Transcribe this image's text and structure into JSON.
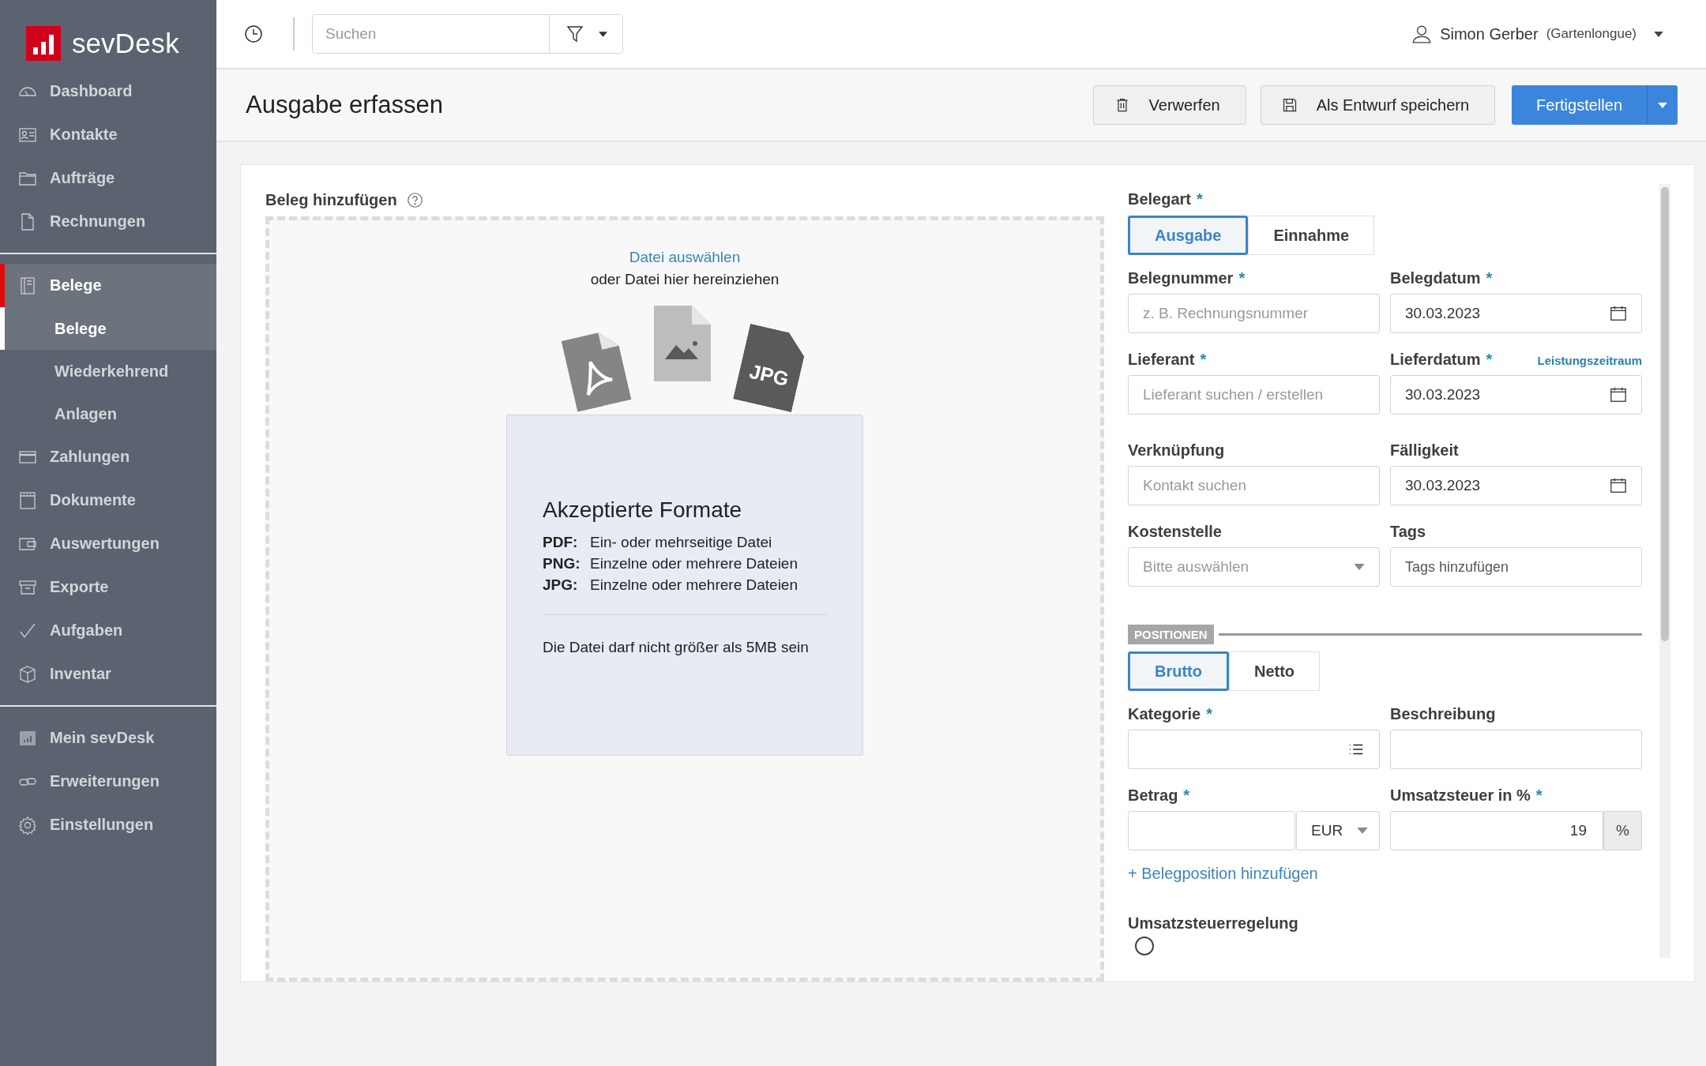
{
  "logo": {
    "text": "sev**Desk**"
  },
  "sidebar": {
    "groups": [
      {
        "items": [
          {
            "label": "Dashboard",
            "selected": false
          },
          {
            "label": "Kontakte",
            "selected": false
          },
          {
            "label": "Aufträge",
            "selected": false
          },
          {
            "label": "Rechnungen",
            "selected": false
          }
        ]
      },
      {
        "items": [
          {
            "label": "Belege",
            "selected": true,
            "children": [
              {
                "label": "Belege",
                "selected": true
              },
              {
                "label": "Wiederkehrend",
                "selected": false
              },
              {
                "label": "Anlagen",
                "selected": false
              }
            ]
          },
          {
            "label": "Zahlungen",
            "selected": false
          },
          {
            "label": "Dokumente",
            "selected": false
          },
          {
            "label": "Auswertungen",
            "selected": false
          },
          {
            "label": "Exporte",
            "selected": false
          },
          {
            "label": "Aufgaben",
            "selected": false
          },
          {
            "label": "Inventar",
            "selected": false
          }
        ]
      },
      {
        "items": [
          {
            "label": "Mein sevDesk",
            "selected": false
          },
          {
            "label": "Erweiterungen",
            "selected": false
          },
          {
            "label": "Einstellungen",
            "selected": false
          }
        ]
      }
    ]
  },
  "topbar": {
    "search_placeholder": "Suchen",
    "user_name": "Simon Gerber",
    "user_org": "(Gartenlongue)"
  },
  "header": {
    "title": "Ausgabe erfassen",
    "buttons": [
      {
        "label": "Verwerfen",
        "kind": "secondary"
      },
      {
        "label": "Als Entwurf speichern",
        "kind": "secondary"
      },
      {
        "label": "Fertigstellen",
        "kind": "primary"
      }
    ]
  },
  "upload": {
    "title": "Beleg hinzufügen",
    "link": "Datei auswählen",
    "hint": "oder Datei hier hereinziehen",
    "files": [
      {
        "kind": "pdf"
      },
      {
        "kind": "image"
      },
      {
        "kind": "jpg",
        "label": "JPG"
      }
    ],
    "formats": {
      "title": "Akzeptierte Formate",
      "rows": [
        {
          "format": "PDF:",
          "description": "Ein- oder mehrseitige Datei"
        },
        {
          "format": "PNG:",
          "description": "Einzelne oder mehrere Dateien"
        },
        {
          "format": "JPG:",
          "description": "Einzelne oder mehrere Dateien"
        }
      ],
      "note": "Die Datei darf nicht größer als 5MB sein"
    }
  },
  "form": {
    "required_mark": "*",
    "type": {
      "label": "Belegart",
      "required": true,
      "options": [
        {
          "label": "Ausgabe",
          "selected": true
        },
        {
          "label": "Einnahme",
          "selected": false
        }
      ]
    },
    "fields": [
      {
        "label": "Belegnummer",
        "required": true,
        "kind": "text",
        "placeholder": "z. B. Rechnungsnummer"
      },
      {
        "label": "Belegdatum",
        "required": true,
        "kind": "date",
        "value": "30.03.2023"
      },
      {
        "label": "Lieferant",
        "required": true,
        "kind": "text",
        "placeholder": "Lieferant suchen / erstellen"
      },
      {
        "label": "Lieferdatum",
        "required": true,
        "kind": "date",
        "value": "30.03.2023",
        "link": "Leistungszeitraum"
      },
      {
        "label": "Verknüpfung",
        "required": false,
        "kind": "text",
        "placeholder": "Kontakt suchen"
      },
      {
        "label": "Fälligkeit",
        "required": false,
        "kind": "date",
        "value": "30.03.2023"
      },
      {
        "label": "Kostenstelle",
        "required": false,
        "kind": "select",
        "placeholder": "Bitte auswählen"
      },
      {
        "label": "Tags",
        "required": false,
        "kind": "tags",
        "placeholder": "Tags hinzufügen"
      }
    ],
    "positions": {
      "tag": "POSITIONEN",
      "modes": [
        {
          "label": "Brutto",
          "selected": true
        },
        {
          "label": "Netto",
          "selected": false
        }
      ],
      "fields": [
        {
          "label": "Kategorie",
          "required": true,
          "kind": "category"
        },
        {
          "label": "Beschreibung",
          "required": false,
          "kind": "text"
        },
        {
          "label": "Betrag",
          "required": true,
          "kind": "amount",
          "currency": "EUR"
        },
        {
          "label": "Umsatzsteuer in %",
          "required": true,
          "kind": "percent",
          "value": "19",
          "suffix": "%"
        }
      ],
      "add_link": "+ Belegposition hinzufügen"
    },
    "vat_rule": {
      "label": "Umsatzsteuerregelung",
      "first_option": {
        "selected": false
      }
    }
  }
}
